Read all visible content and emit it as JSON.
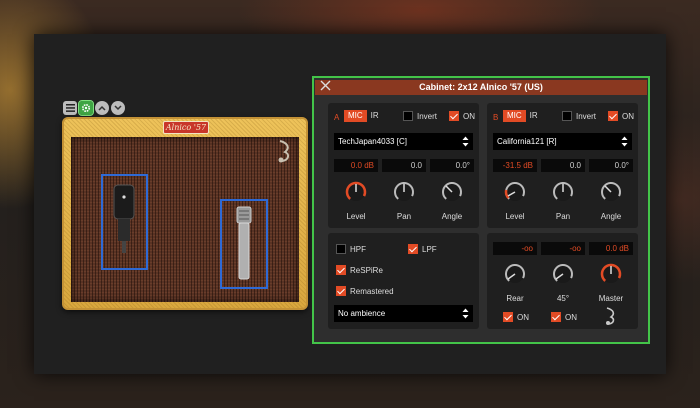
{
  "amp": {
    "badge": "Alnico '57"
  },
  "cabinet": {
    "title": "Cabinet: 2x12 Alnico '57 (US)",
    "channel_a": {
      "letter": "A",
      "mode_mic": "MIC",
      "mode_ir": "IR",
      "invert_label": "Invert",
      "invert_checked": false,
      "on_label": "ON",
      "on_checked": true,
      "mic_select": "TechJapan4033 [C]",
      "level_value": "0.0 dB",
      "pan_value": "0.0",
      "angle_value": "0.0°",
      "knob_labels": {
        "level": "Level",
        "pan": "Pan",
        "angle": "Angle"
      }
    },
    "channel_b": {
      "letter": "B",
      "mode_mic": "MIC",
      "mode_ir": "IR",
      "invert_label": "Invert",
      "invert_checked": false,
      "on_label": "ON",
      "on_checked": true,
      "mic_select": "California121 [R]",
      "level_value": "-31.5 dB",
      "pan_value": "0.0",
      "angle_value": "0.0°",
      "knob_labels": {
        "level": "Level",
        "pan": "Pan",
        "angle": "Angle"
      }
    },
    "filters": {
      "hpf_label": "HPF",
      "hpf_checked": false,
      "lpf_label": "LPF",
      "lpf_checked": true,
      "respire_label": "ReSPiRe",
      "respire_checked": true,
      "remastered_label": "Remastered",
      "remastered_checked": true,
      "ambience_select": "No ambience"
    },
    "room": {
      "rear_value": "-oo",
      "deg45_value": "-oo",
      "master_value": "0.0 dB",
      "rear_label": "Rear",
      "deg45_label": "45°",
      "master_label": "Master",
      "rear_on_label": "ON",
      "rear_on_checked": true,
      "deg45_on_label": "ON",
      "deg45_on_checked": true
    }
  },
  "colors": {
    "accent": "#e24b25",
    "highlight_green": "#43c449",
    "mic_box_blue": "#2e6ad6",
    "title_bar": "#8a3820"
  },
  "icons": [
    "menu-icon",
    "gear-icon",
    "chevron-up-icon",
    "chevron-down-icon",
    "close-icon",
    "music-note-icon",
    "select-arrows-icon"
  ]
}
